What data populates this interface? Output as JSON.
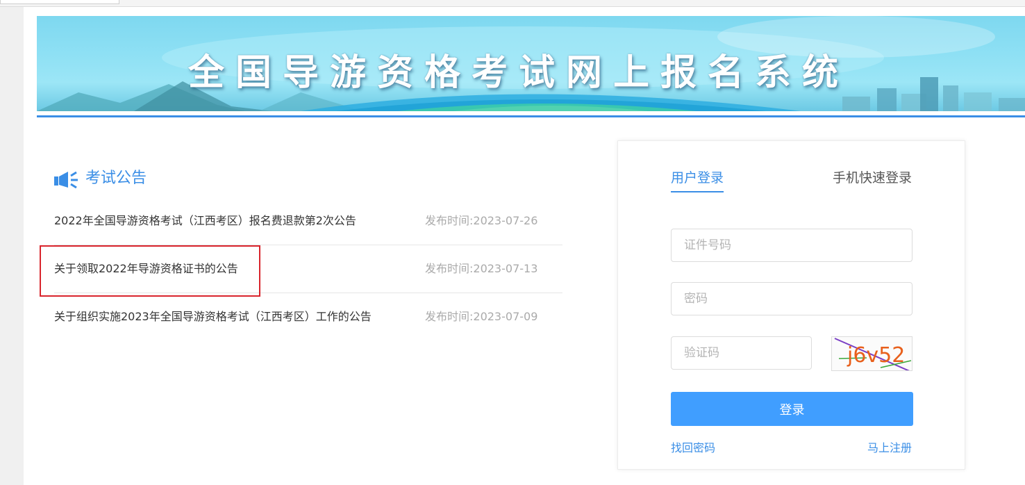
{
  "banner": {
    "title": "全国导游资格考试网上报名系统"
  },
  "notices": {
    "heading": "考试公告",
    "icon": "megaphone-icon",
    "items": [
      {
        "title": "2022年全国导游资格考试（江西考区）报名费退款第2次公告",
        "date": "发布时间:2023-07-26"
      },
      {
        "title": "关于领取2022年导游资格证书的公告",
        "date": "发布时间:2023-07-13"
      },
      {
        "title": "关于组织实施2023年全国导游资格考试（江西考区）工作的公告",
        "date": "发布时间:2023-07-09"
      }
    ]
  },
  "login": {
    "tabs": {
      "user": "用户登录",
      "phone": "手机快速登录"
    },
    "id_placeholder": "证件号码",
    "password_placeholder": "密码",
    "captcha_placeholder": "验证码",
    "captcha_text": "j6v52",
    "submit_label": "登录",
    "forgot_label": "找回密码",
    "register_label": "马上注册"
  },
  "colors": {
    "accent": "#3a8ee6",
    "button": "#409eff",
    "highlight": "#d9242c"
  }
}
